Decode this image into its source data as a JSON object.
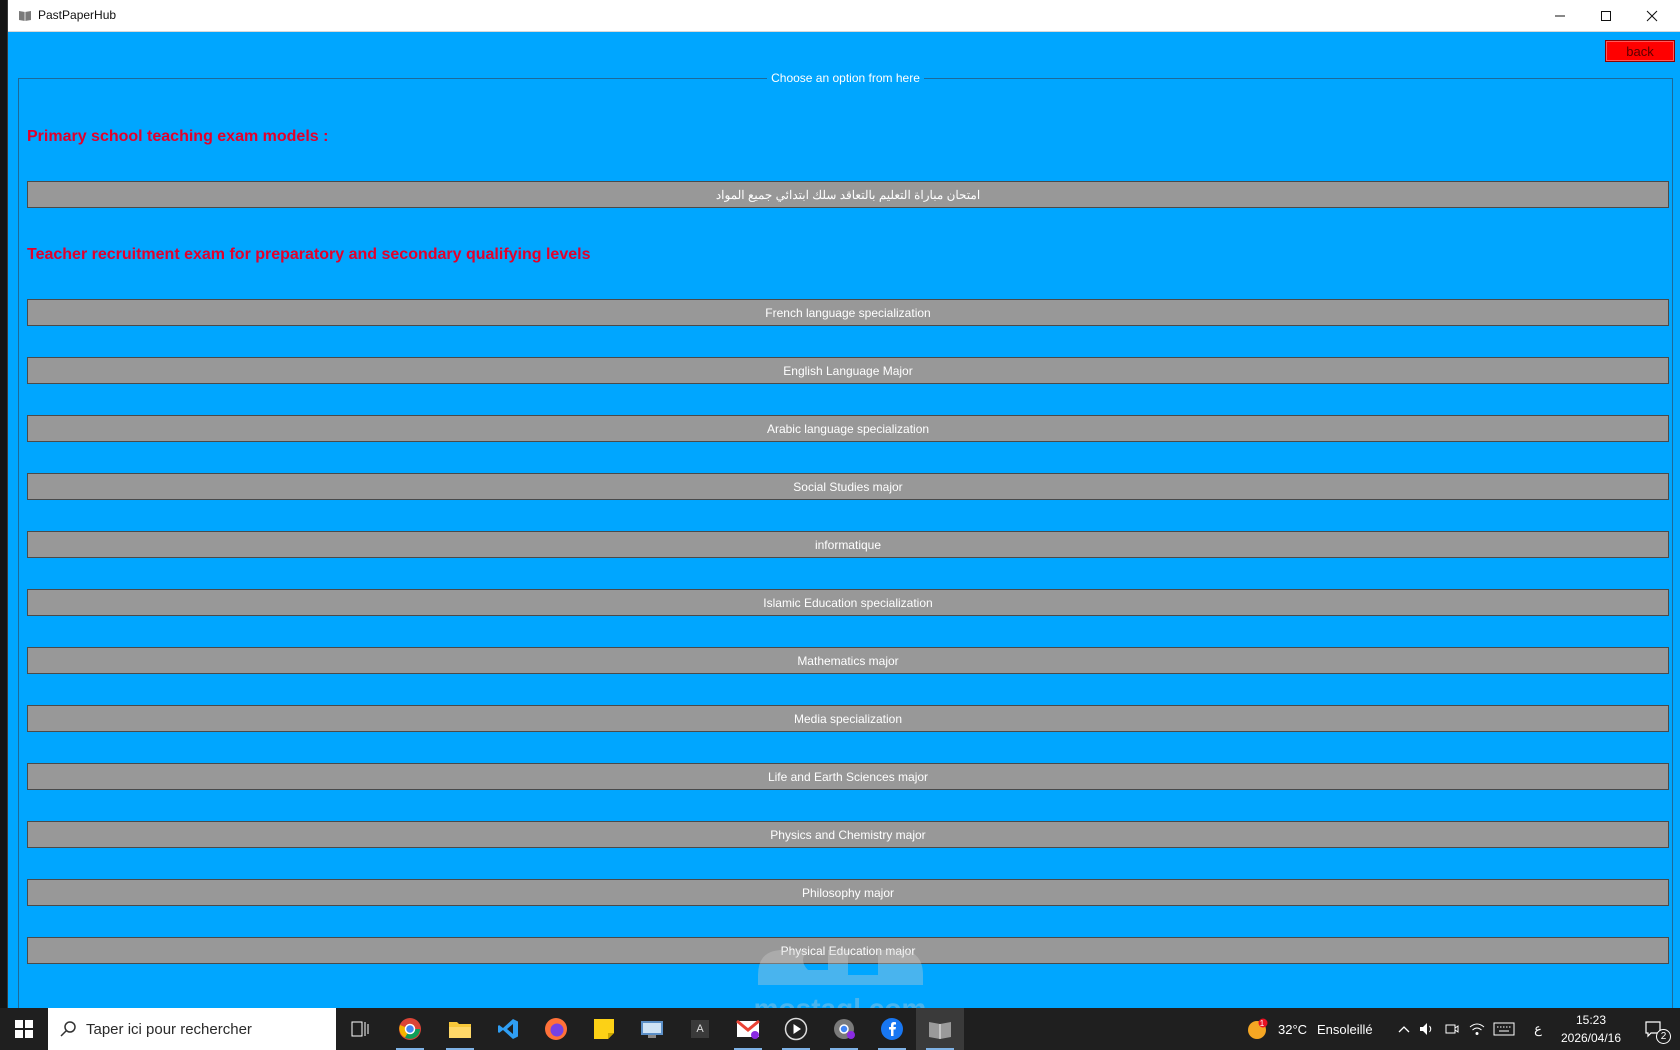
{
  "window": {
    "title": "PastPaperHub",
    "back_label": "back",
    "group_title": "Choose an option from here",
    "sections": {
      "primary_heading": "Primary school teaching exam models :",
      "primary_buttons": [
        "امتحان مباراة التعليم بالتعاقد سلك ابتدائي جميع المواد"
      ],
      "secondary_heading": "Teacher recruitment exam for preparatory and secondary qualifying levels",
      "secondary_buttons": [
        "French language specialization",
        "English Language Major",
        "Arabic language specialization",
        "Social Studies major",
        "informatique",
        "Islamic Education specialization",
        "Mathematics major",
        "Media specialization",
        "Life and Earth Sciences major",
        "Physics and Chemistry major",
        "Philosophy major",
        "Physical Education major"
      ]
    },
    "colors": {
      "background": "#00a6ff",
      "heading": "#e3002b",
      "button": "#989898",
      "back_button": "#ff0000"
    }
  },
  "watermark": {
    "text": "mostaql.com"
  },
  "taskbar": {
    "search_placeholder": "Taper ici pour rechercher",
    "apps": [
      "chrome-icon",
      "file-explorer-icon",
      "vscode-icon",
      "firefox-icon",
      "sticky-notes-icon",
      "control-panel-icon",
      "font-app-icon",
      "gmail-icon",
      "media-player-icon",
      "chrome-profile-icon",
      "facebook-icon",
      "pastpaperhub-icon"
    ],
    "weather_badge": "1",
    "weather_temp": "32°C",
    "weather_desc": "Ensoleillé",
    "language": "ع",
    "time": "15:23",
    "date": "2026/04/16",
    "notification_count": "2"
  }
}
